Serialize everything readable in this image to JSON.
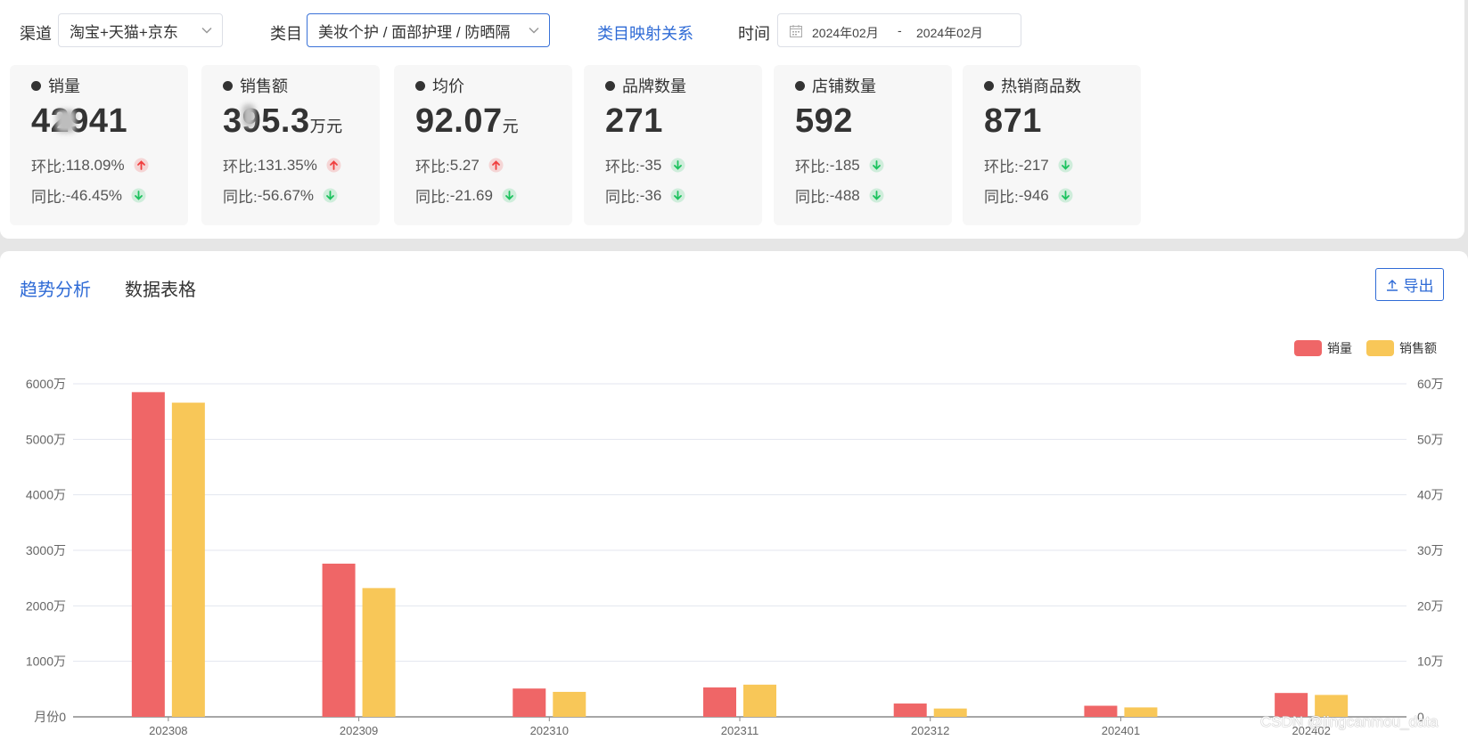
{
  "filters": {
    "channel_label": "渠道",
    "channel_value": "淘宝+天猫+京东",
    "category_label": "类目",
    "category_value": "美妆个护 / 面部护理 / 防晒隔",
    "mapping_link": "类目映射关系",
    "time_label": "时间",
    "date_start": "2024年02月",
    "date_sep": "-",
    "date_end": "2024年02月"
  },
  "cards": [
    {
      "title": "销量",
      "value": "42941",
      "unit": "",
      "mom_label": "环比:",
      "mom": "118.09%",
      "mom_dir": "up",
      "yoy_label": "同比:",
      "yoy": "-46.45%",
      "yoy_dir": "down"
    },
    {
      "title": "销售额",
      "value": "395.3",
      "unit": "万元",
      "mom_label": "环比:",
      "mom": "131.35%",
      "mom_dir": "up",
      "yoy_label": "同比:",
      "yoy": "-56.67%",
      "yoy_dir": "down"
    },
    {
      "title": "均价",
      "value": "92.07",
      "unit": "元",
      "mom_label": "环比:",
      "mom": "5.27",
      "mom_dir": "up",
      "yoy_label": "同比:",
      "yoy": "-21.69",
      "yoy_dir": "down"
    },
    {
      "title": "品牌数量",
      "value": "271",
      "unit": "",
      "mom_label": "环比:",
      "mom": "-35",
      "mom_dir": "down",
      "yoy_label": "同比:",
      "yoy": "-36",
      "yoy_dir": "down"
    },
    {
      "title": "店铺数量",
      "value": "592",
      "unit": "",
      "mom_label": "环比:",
      "mom": "-185",
      "mom_dir": "down",
      "yoy_label": "同比:",
      "yoy": "-488",
      "yoy_dir": "down"
    },
    {
      "title": "热销商品数",
      "value": "871",
      "unit": "",
      "mom_label": "环比:",
      "mom": "-217",
      "mom_dir": "down",
      "yoy_label": "同比:",
      "yoy": "-946",
      "yoy_dir": "down"
    }
  ],
  "tabs": {
    "trend": "趋势分析",
    "table": "数据表格"
  },
  "export_label": "导出",
  "colors": {
    "accent": "#2f6bd6",
    "up": "#f03e3e",
    "down": "#1cc25e",
    "sales_volume": "#ef6667",
    "sales_amount": "#f8c758"
  },
  "chart_data": {
    "type": "bar",
    "categories": [
      "202308",
      "202309",
      "202310",
      "202311",
      "202312",
      "202401",
      "202402"
    ],
    "series": [
      {
        "name": "销量",
        "axis": "left",
        "values": [
          58500000,
          27600000,
          5100000,
          5300000,
          2400000,
          2000000,
          4300000
        ]
      },
      {
        "name": "销售额",
        "axis": "right",
        "values": [
          566000,
          232000,
          45000,
          58000,
          15000,
          17000,
          39500
        ]
      }
    ],
    "left_axis": {
      "ylim": [
        0,
        60000000
      ],
      "ticks": [
        "月份0",
        "1000万",
        "2000万",
        "3000万",
        "4000万",
        "5000万",
        "6000万"
      ]
    },
    "right_axis": {
      "ylim": [
        0,
        600000
      ],
      "ticks": [
        "0",
        "10万",
        "20万",
        "30万",
        "40万",
        "50万",
        "60万"
      ]
    },
    "legend_position": "top-right",
    "grid": true
  },
  "watermark": "CSDN @jingcanmou_data"
}
